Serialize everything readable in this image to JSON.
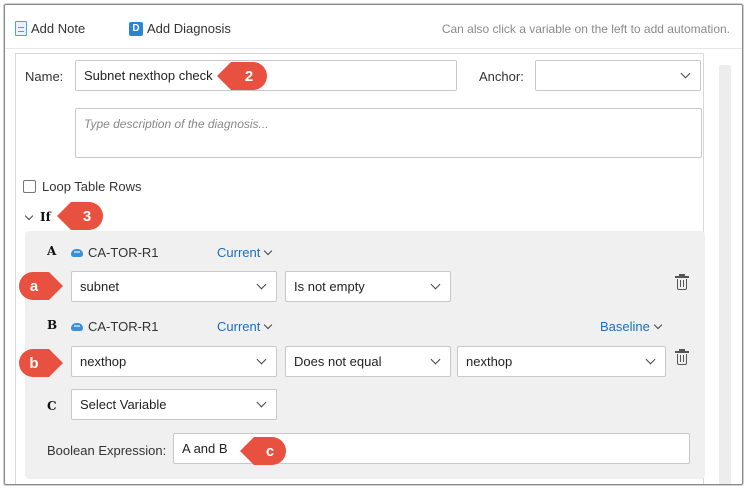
{
  "toolbar": {
    "add_note_label": "Add Note",
    "add_diagnosis_label": "Add Diagnosis",
    "diagnosis_icon_letter": "D",
    "hint": "Can also click a variable on the left to add automation."
  },
  "form": {
    "name_label": "Name:",
    "name_value": "Subnet nexthop check",
    "anchor_label": "Anchor:",
    "anchor_value": "",
    "description_placeholder": "Type description of the diagnosis...",
    "loop_label": "Loop Table Rows",
    "if_label": "If"
  },
  "conditions": {
    "a": {
      "letter": "A",
      "device": "CA-TOR-R1",
      "mode": "Current",
      "variable": "subnet",
      "operator": "Is not empty"
    },
    "b": {
      "letter": "B",
      "device": "CA-TOR-R1",
      "mode": "Current",
      "compare_mode": "Baseline",
      "variable": "nexthop",
      "operator": "Does not equal",
      "compare_variable": "nexthop"
    },
    "c": {
      "letter": "C",
      "variable": "Select Variable"
    },
    "boolean_label": "Boolean Expression:",
    "boolean_value": "A and B"
  },
  "callouts": {
    "name": "2",
    "if": "3",
    "row_a": "a",
    "row_b": "b",
    "boolean": "c"
  },
  "colors": {
    "callout": "#e8503f",
    "link": "#1a6fbf",
    "panel": "#f0f0f0"
  }
}
